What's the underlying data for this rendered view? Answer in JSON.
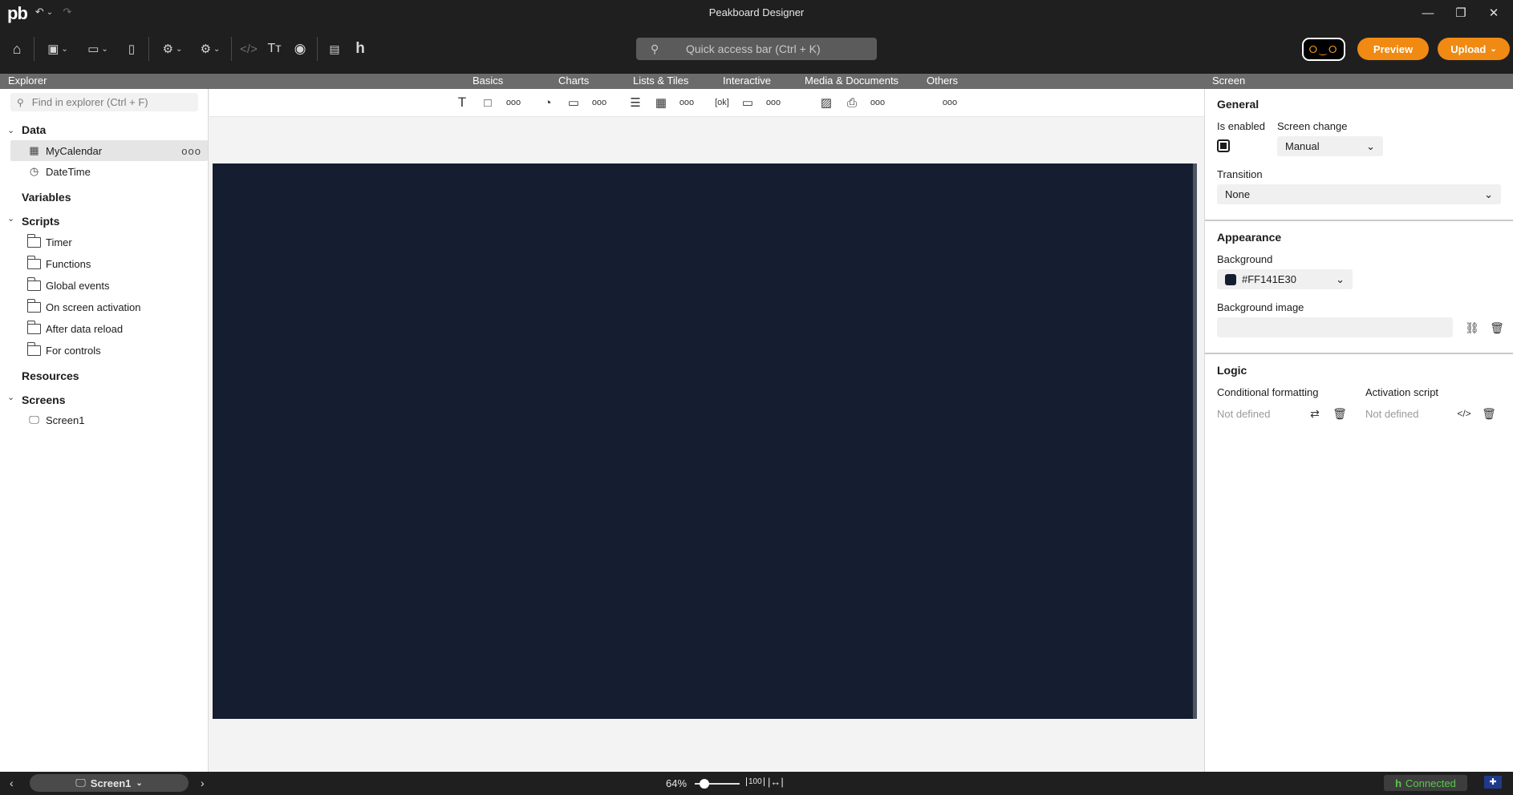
{
  "app": {
    "title": "Peakboard Designer",
    "logo": "pb"
  },
  "toolbar": {
    "quick_access_placeholder": "Quick access bar (Ctrl + K)",
    "preview_label": "Preview",
    "upload_label": "Upload"
  },
  "ribbon": {
    "explorer_header": "Explorer",
    "categories": [
      "Basics",
      "Charts",
      "Lists & Tiles",
      "Interactive",
      "Media & Documents",
      "Others"
    ],
    "properties_header": "Screen"
  },
  "explorer": {
    "search_placeholder": "Find in explorer (Ctrl + F)",
    "sections": {
      "data": "Data",
      "variables": "Variables",
      "scripts": "Scripts",
      "resources": "Resources",
      "screens": "Screens"
    },
    "data_items": [
      "MyCalendar",
      "DateTime"
    ],
    "script_items": [
      "Timer",
      "Functions",
      "Global events",
      "On screen activation",
      "After data reload",
      "For controls"
    ],
    "screen_items": [
      "Screen1"
    ]
  },
  "canvas": {
    "background": "#141E30"
  },
  "properties": {
    "general": {
      "heading": "General",
      "is_enabled_label": "Is enabled",
      "is_enabled": true,
      "screen_change_label": "Screen change",
      "screen_change_value": "Manual",
      "transition_label": "Transition",
      "transition_value": "None"
    },
    "appearance": {
      "heading": "Appearance",
      "background_label": "Background",
      "background_value": "#FF141E30",
      "background_image_label": "Background image"
    },
    "logic": {
      "heading": "Logic",
      "conditional_formatting_label": "Conditional formatting",
      "conditional_formatting_value": "Not defined",
      "activation_script_label": "Activation script",
      "activation_script_value": "Not defined"
    }
  },
  "statusbar": {
    "current_screen": "Screen1",
    "zoom": "64%",
    "zoom_fit_label": "100",
    "connection_status": "Connected",
    "connection_color": "#59c94b"
  },
  "colors": {
    "accent": "#f08a12",
    "titlebar": "#1f1f1f"
  }
}
